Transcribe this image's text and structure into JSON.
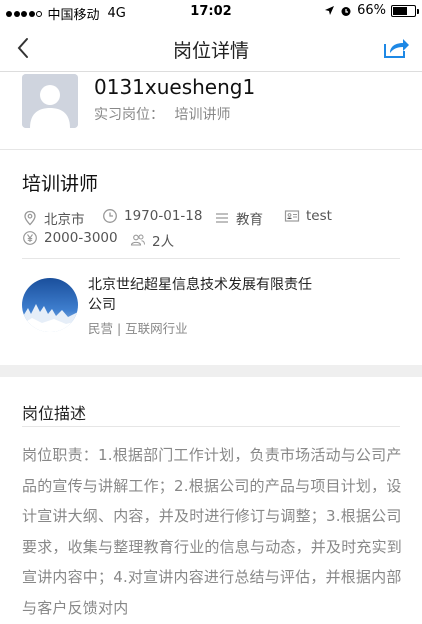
{
  "status_bar": {
    "carrier": "中国移动",
    "network": "4G",
    "time": "17:02",
    "battery": "66%",
    "battery_level": 0.66
  },
  "nav": {
    "title": "岗位详情"
  },
  "student": {
    "name": "0131xuesheng1",
    "position_label": "实习岗位：",
    "position_value": "培训讲师"
  },
  "job": {
    "title": "培训讲师",
    "location": "北京市",
    "date": "1970-01-18",
    "category": "教育",
    "tag": "test",
    "salary": "2000-3000",
    "count": "2人"
  },
  "company": {
    "name": "北京世纪超星信息技术发展有限责任公司",
    "type": "民营 | 互联网行业"
  },
  "description": {
    "heading": "岗位描述",
    "text": "岗位职责：1.根据部门工作计划，负责市场活动与公司产品的宣传与讲解工作；2.根据公司的产品与项目计划，设计宣讲大纲、内容，并及时进行修订与调整；3.根据公司要求，收集与整理教育行业的信息与动态，并及时充实到宣讲内容中；4.对宣讲内容进行总结与评估，并根据内部与客户反馈对内"
  },
  "colors": {
    "accent": "#1e88e5",
    "muted": "#888888"
  }
}
